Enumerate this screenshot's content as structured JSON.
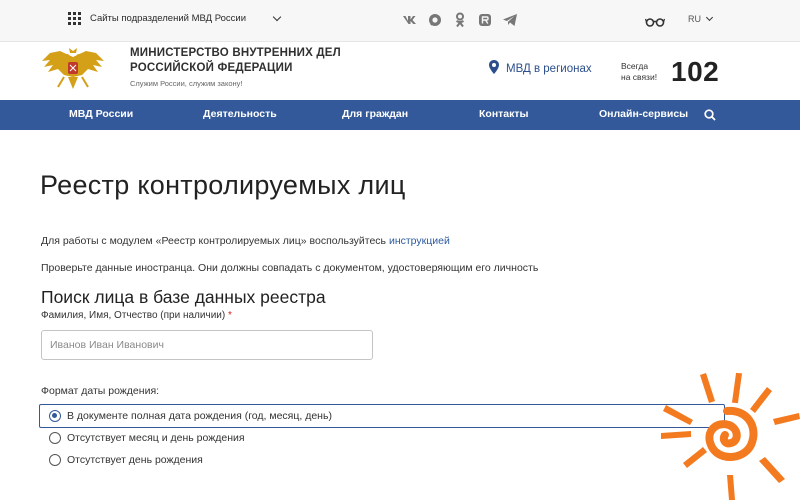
{
  "topbar": {
    "sites_label": "Сайты подразделений МВД России",
    "social_icons": [
      "vk-icon",
      "ok-circle-icon",
      "odnoklassniki-icon",
      "rutube-icon",
      "telegram-icon"
    ],
    "language": "RU"
  },
  "header": {
    "org_name_line1": "МИНИСТЕРСТВО ВНУТРЕННИХ ДЕЛ",
    "org_name_line2": "РОССИЙСКОЙ ФЕДЕРАЦИИ",
    "motto": "Служим России, служим закону!",
    "regions_label": "МВД в регионах",
    "hotline_line1": "Всегда",
    "hotline_line2": "на связи!",
    "hotline_number": "102"
  },
  "nav": {
    "items": [
      {
        "label": "МВД России"
      },
      {
        "label": "Деятельность"
      },
      {
        "label": "Для граждан"
      },
      {
        "label": "Контакты"
      },
      {
        "label": "Онлайн-сервисы"
      }
    ]
  },
  "main": {
    "title": "Реестр контролируемых лиц",
    "intro_text": "Для работы с модулем «Реестр контролируемых лиц» воспользуйтесь ",
    "intro_link": "инструкцией",
    "check_text": "Проверьте данные иностранца. Они должны совпадать с документом, удостоверяющим его личность",
    "search_heading": "Поиск лица в базе данных реестра",
    "name_label": "Фамилия, Имя, Отчество (при наличии)",
    "required_mark": "*",
    "name_placeholder": "Иванов Иван Иванович",
    "format_label": "Формат даты рождения:",
    "options": [
      {
        "label": "В документе полная дата рождения (год, месяц, день)",
        "selected": true
      },
      {
        "label": "Отсутствует месяц и день рождения",
        "selected": false
      },
      {
        "label": "Отсутствует день рождения",
        "selected": false
      }
    ]
  },
  "colors": {
    "nav_bg": "#33599a",
    "link": "#2c5aa0",
    "sun": "#f47a20",
    "emblem": "#d4a017"
  }
}
